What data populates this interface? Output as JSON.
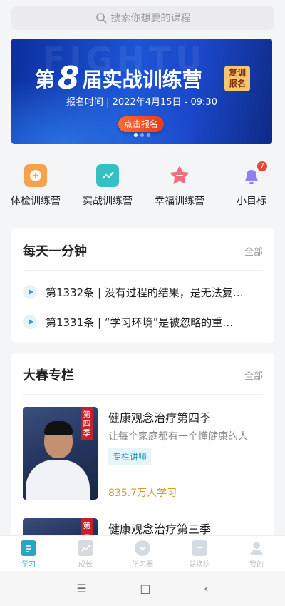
{
  "search": {
    "placeholder": "搜索你想要的课程"
  },
  "banner": {
    "watermark": "FIGHTU",
    "title_prefix": "第",
    "title_num": "8",
    "title_suffix": "届实战训练营",
    "badge_line1": "复训",
    "badge_line2": "报名",
    "time_text": "报名时间 | 2022年4月15日 - 09:30",
    "cta_label": "点击报名"
  },
  "quick": [
    {
      "label": "体检训练营",
      "color": "#f6a24a"
    },
    {
      "label": "实战训练营",
      "color": "#35c0c4"
    },
    {
      "label": "幸福训练营",
      "color": "#ef6e7e"
    },
    {
      "label": "小目标",
      "color": "#8f7ff2",
      "badge": "7"
    }
  ],
  "daily": {
    "title": "每天一分钟",
    "more": "全部",
    "items": [
      "第1332条 | 没有过程的结果，是无法复…",
      "第1331条 | “学习环境”是被忽略的重…"
    ]
  },
  "column": {
    "title": "大春专栏",
    "more": "全部",
    "courses": [
      {
        "title": "健康观念治疗第四季",
        "subtitle": "让每个家庭都有一个懂健康的人",
        "chip": "专栏讲师",
        "count": "835.7万人学习",
        "tag": "第四季"
      },
      {
        "title": "健康观念治疗第三季",
        "tag": "第三"
      }
    ]
  },
  "tabs": [
    {
      "label": "学习",
      "active": true
    },
    {
      "label": "成长"
    },
    {
      "label": "学习圈"
    },
    {
      "label": "兑换坊"
    },
    {
      "label": "我的"
    }
  ],
  "sysnav": {
    "menu": "☰",
    "home": "□",
    "back": "‹"
  }
}
